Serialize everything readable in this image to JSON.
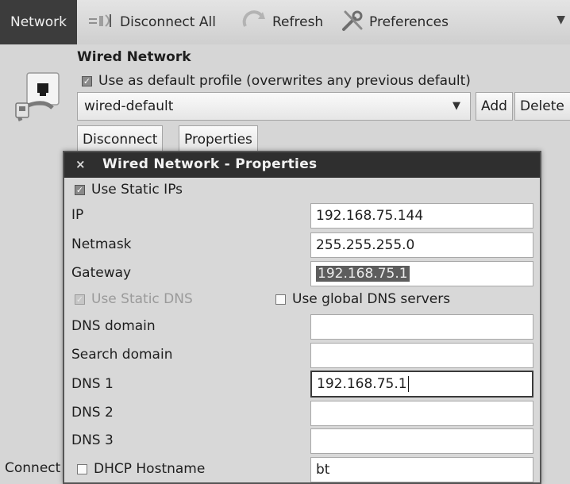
{
  "toolbar": {
    "tab_network": "Network",
    "disconnect_all": "Disconnect All",
    "refresh": "Refresh",
    "preferences": "Preferences",
    "menu_arrow": "▼"
  },
  "main": {
    "section_title": "Wired Network",
    "default_profile_label": "Use as default profile (overwrites any previous default)",
    "default_profile_checked": true,
    "profile_value": "wired-default",
    "add_label": "Add",
    "delete_label": "Delete",
    "disconnect_label": "Disconnect",
    "properties_label": "Properties",
    "status_text": "Connect"
  },
  "dialog": {
    "close_glyph": "×",
    "title": "Wired Network - Properties",
    "use_static_ips": "Use Static IPs",
    "use_static_ips_checked": true,
    "ip_label": "IP",
    "ip_value": "192.168.75.144",
    "netmask_label": "Netmask",
    "netmask_value": "255.255.255.0",
    "gateway_label": "Gateway",
    "gateway_value": "192.168.75.1",
    "use_static_dns": "Use Static DNS",
    "use_static_dns_checked": true,
    "use_global_dns": "Use global DNS servers",
    "use_global_dns_checked": false,
    "dns_domain_label": "DNS domain",
    "dns_domain_value": "",
    "search_domain_label": "Search domain",
    "search_domain_value": "",
    "dns1_label": "DNS 1",
    "dns1_value": "192.168.75.1",
    "dns2_label": "DNS 2",
    "dns2_value": "",
    "dns3_label": "DNS 3",
    "dns3_value": "",
    "dhcp_hostname_label": "DHCP Hostname",
    "dhcp_hostname_checked": false,
    "dhcp_hostname_value": "bt"
  }
}
